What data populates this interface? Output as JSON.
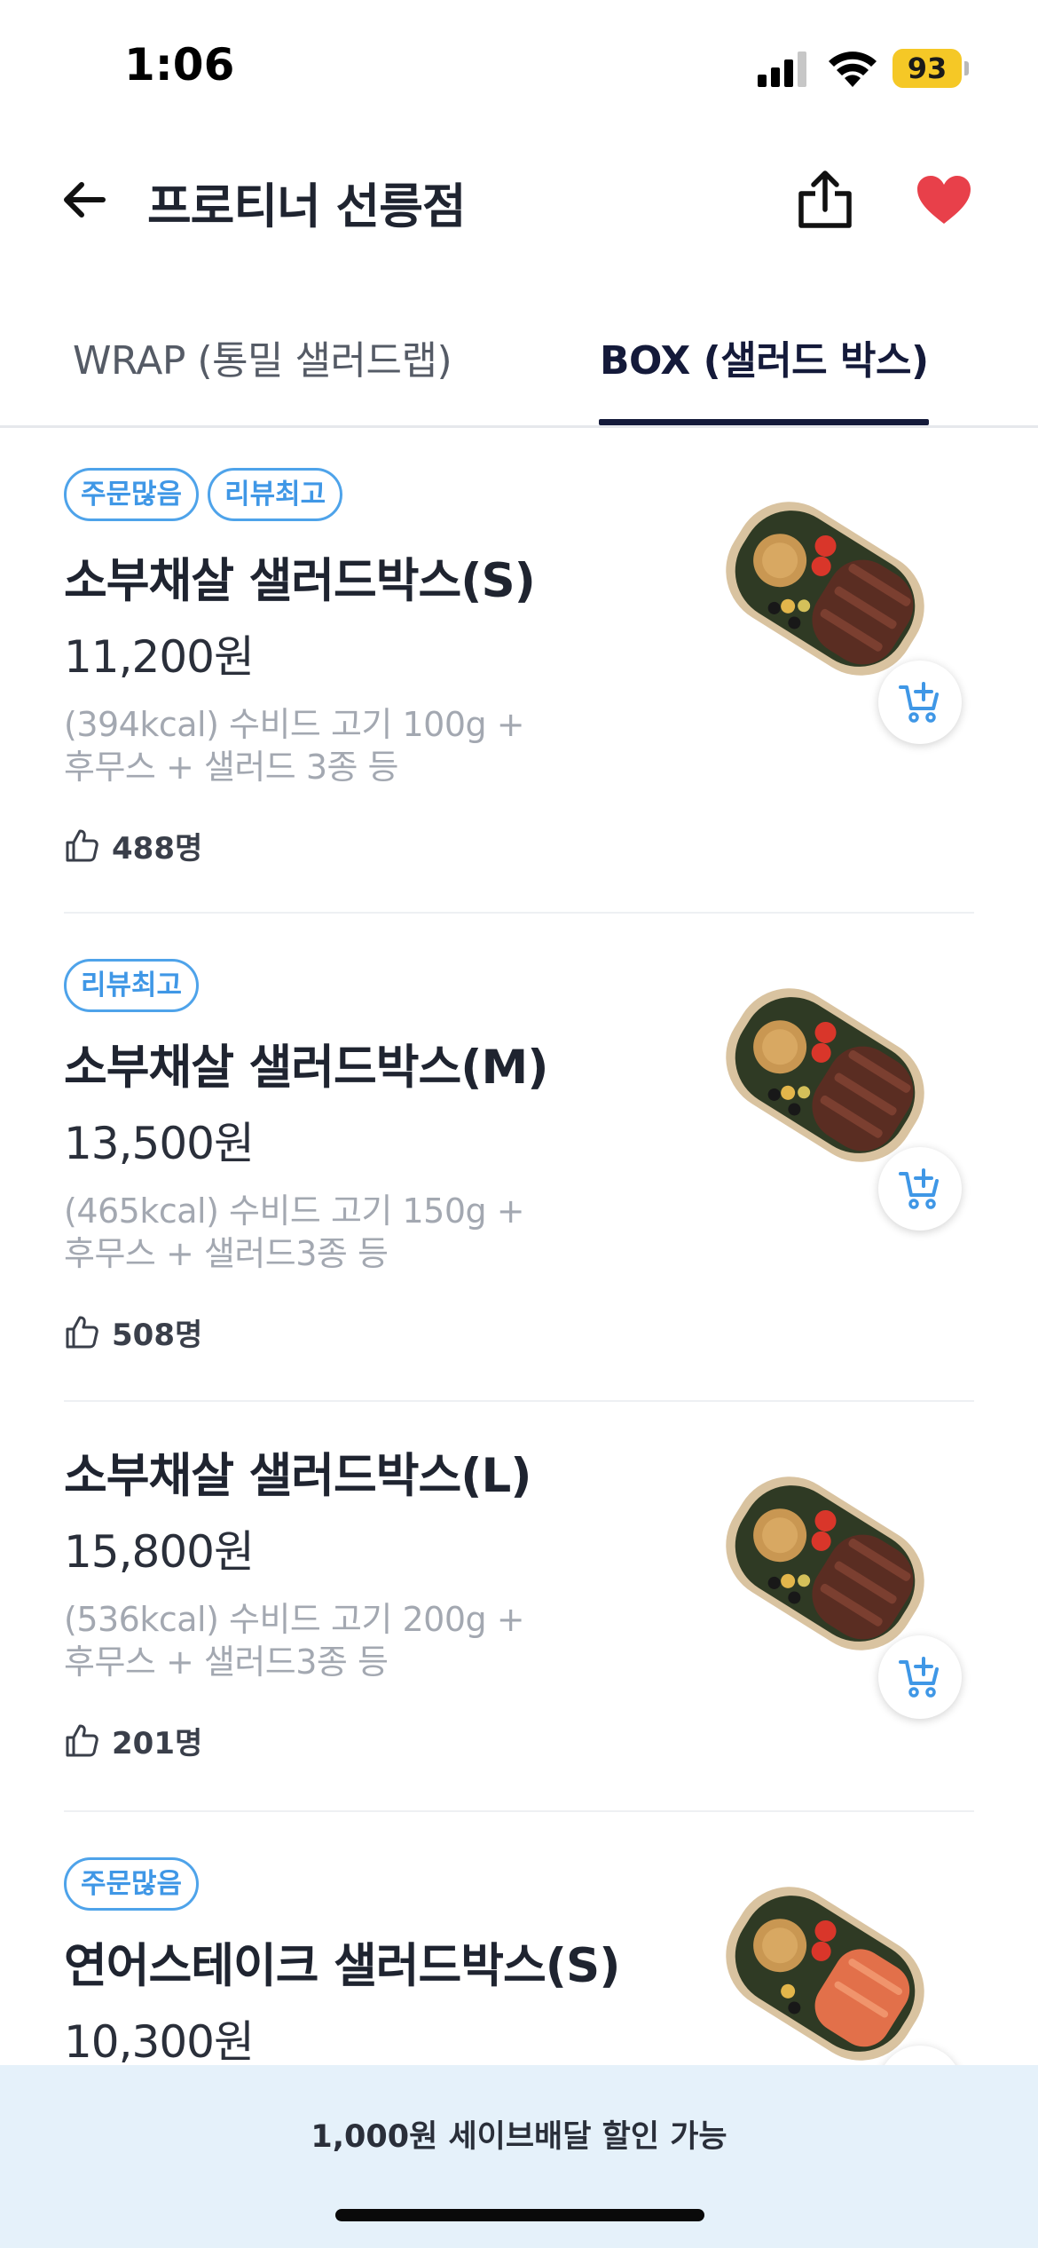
{
  "status_bar": {
    "time": "1:06",
    "battery": "93"
  },
  "header": {
    "title": "프로티너 선릉점"
  },
  "tabs": [
    {
      "label": "WRAP (통밀 샐러드랩)",
      "selected": false
    },
    {
      "label": "BOX (샐러드 박스)",
      "selected": true
    }
  ],
  "colors": {
    "accent_blue": "#4ea3ea",
    "heart_red": "#e8404a",
    "tab_active": "#141a3a",
    "banner_bg": "#e5f1fa"
  },
  "items": [
    {
      "badges": [
        "주문많음",
        "리뷰최고"
      ],
      "name": "소부채살 샐러드박스(S)",
      "price": "11,200원",
      "desc_line1": "(394kcal) 수비드 고기 100g +",
      "desc_line2": "후무스 + 샐러드 3종 등",
      "likes": "488명"
    },
    {
      "badges": [
        "리뷰최고"
      ],
      "name": "소부채살 샐러드박스(M)",
      "price": "13,500원",
      "desc_line1": "(465kcal) 수비드 고기 150g +",
      "desc_line2": "후무스 + 샐러드3종 등",
      "likes": "508명"
    },
    {
      "badges": [],
      "name": "소부채살 샐러드박스(L)",
      "price": "15,800원",
      "desc_line1": "(536kcal) 수비드 고기 200g +",
      "desc_line2": "후무스 + 샐러드3종 등",
      "likes": "201명"
    },
    {
      "badges": [
        "주문많음"
      ],
      "name": "연어스테이크 샐러드박스(S)",
      "price": "10,300원"
    }
  ],
  "banner": {
    "text": "1,000원 세이브배달 할인 가능"
  }
}
